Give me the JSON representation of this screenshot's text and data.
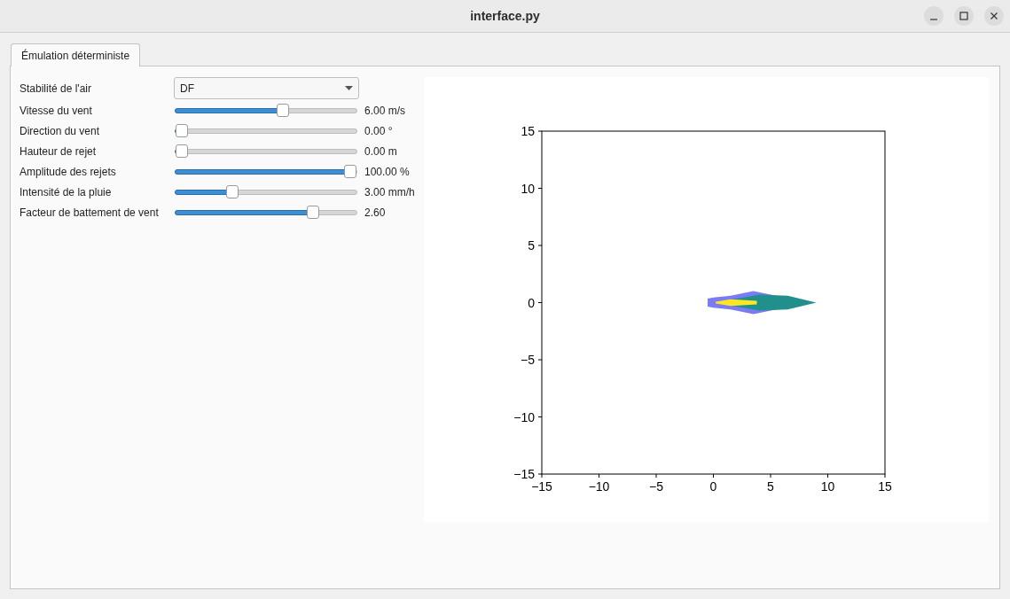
{
  "window": {
    "title": "interface.py"
  },
  "tabs": [
    {
      "label": "Émulation déterministe",
      "selected": true
    }
  ],
  "form": {
    "dropdown": {
      "label": "Stabilité de l'air",
      "value": "DF"
    },
    "sliders": [
      {
        "label": "Vitesse du vent",
        "level": 0.6,
        "reading": "6.00 m/s"
      },
      {
        "label": "Direction du vent",
        "level": 0,
        "reading": "0.00 °"
      },
      {
        "label": "Hauteur de rejet",
        "level": 0,
        "reading": "0.00 m"
      },
      {
        "label": "Amplitude des rejets",
        "level": 1,
        "reading": "100.00 %"
      },
      {
        "label": "Intensité de la pluie",
        "level": 0.3,
        "reading": "3.00 mm/h"
      },
      {
        "label": "Facteur de battement de vent",
        "level": 0.78,
        "reading": "2.60"
      }
    ]
  },
  "plot": {
    "xticks": [
      "−15",
      "−10",
      "−5",
      "0",
      "5",
      "10",
      "15"
    ],
    "yticks": [
      "15",
      "10",
      "5",
      "0",
      "−5",
      "−10",
      "−15"
    ]
  }
}
